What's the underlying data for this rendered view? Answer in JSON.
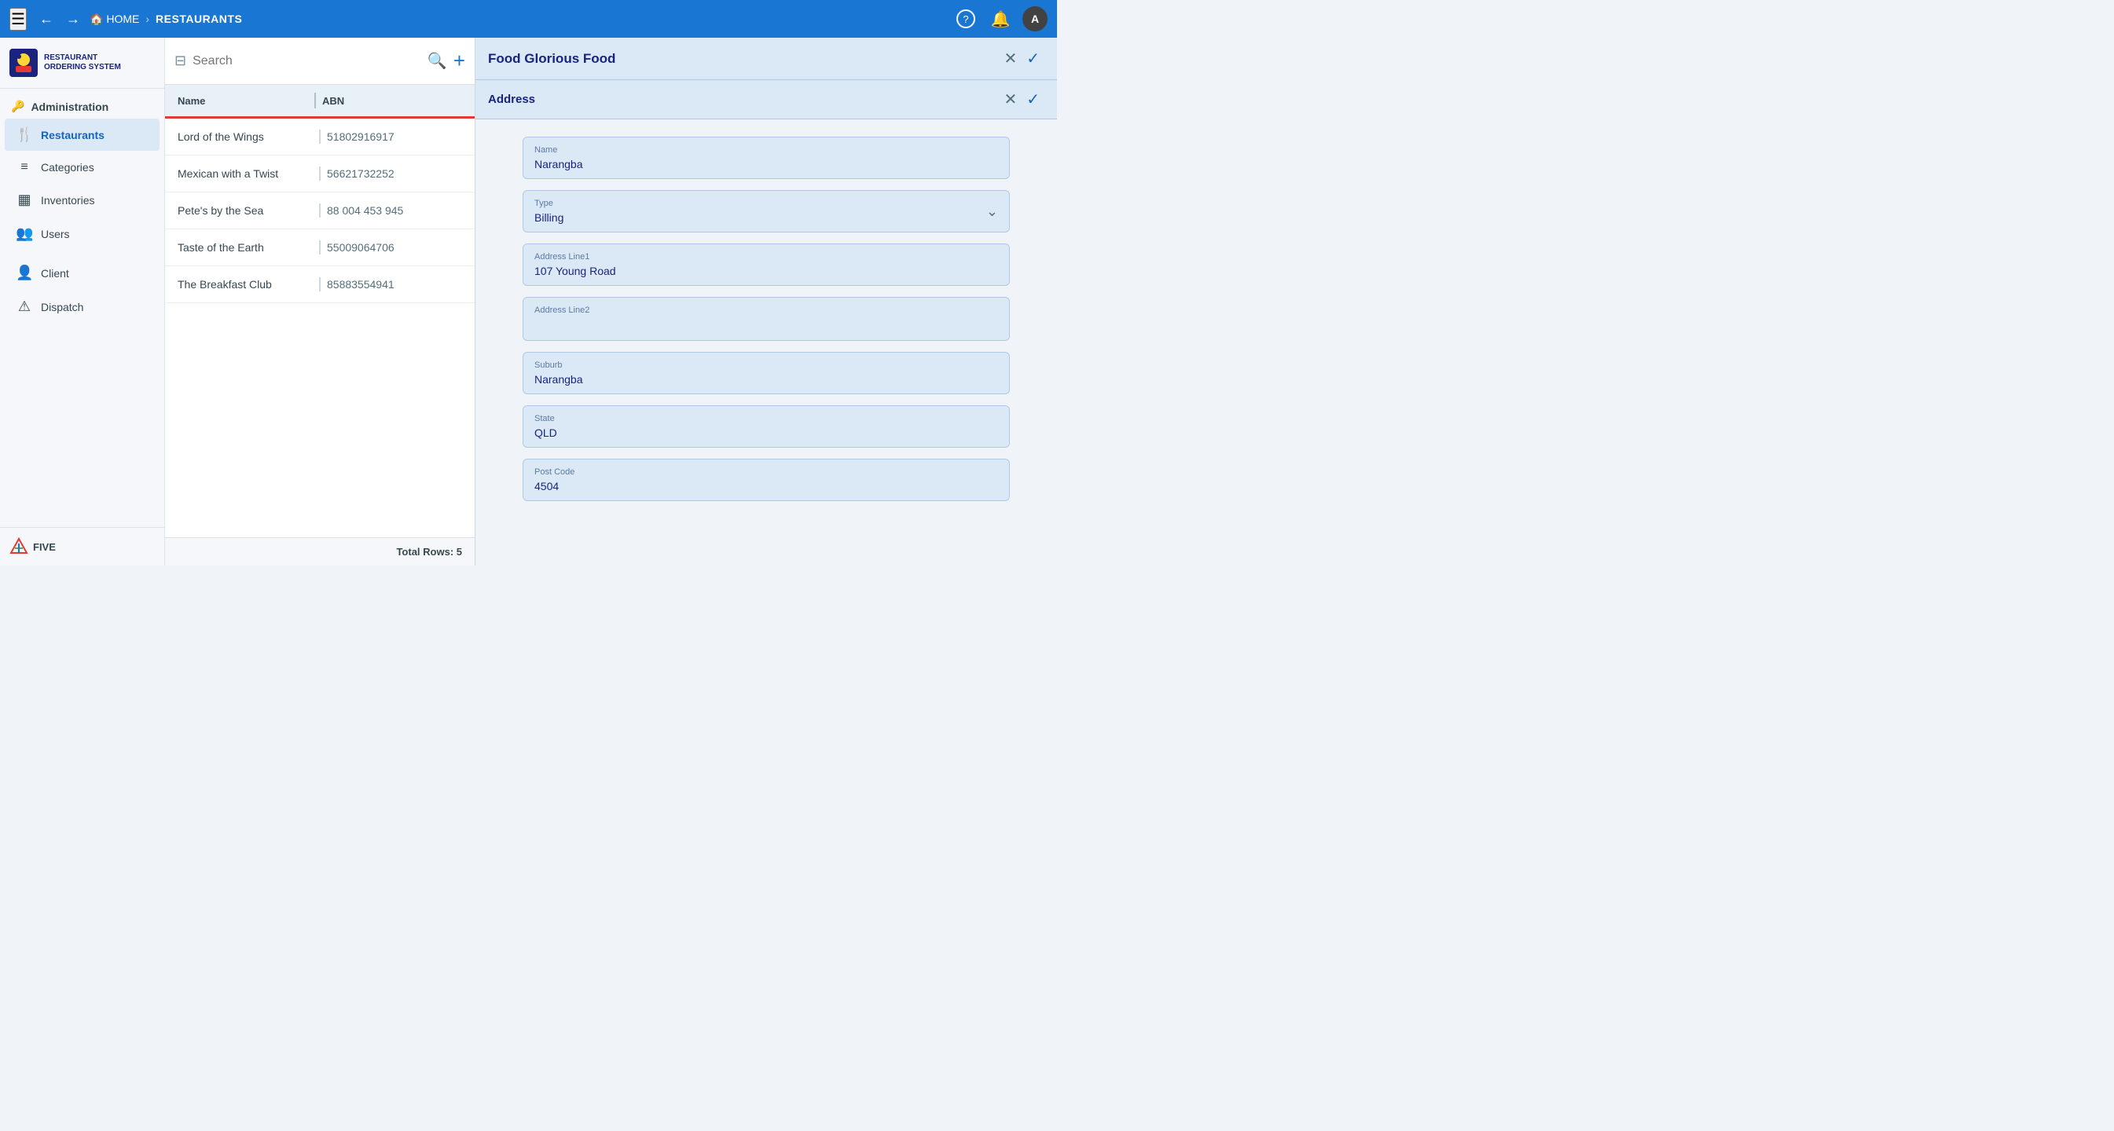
{
  "topbar": {
    "menu_icon": "☰",
    "back_icon": "←",
    "forward_icon": "→",
    "home_label": "HOME",
    "separator": "›",
    "page_label": "RESTAURANTS",
    "help_icon": "?",
    "bell_icon": "🔔",
    "avatar_label": "A"
  },
  "sidebar": {
    "logo_text_line1": "RESTAURANT",
    "logo_text_line2": "ORDERING SYSTEM",
    "section_administration": "Administration",
    "items": [
      {
        "id": "restaurants",
        "label": "Restaurants",
        "icon": "🍴",
        "active": true
      },
      {
        "id": "categories",
        "label": "Categories",
        "icon": "≡",
        "active": false
      },
      {
        "id": "inventories",
        "label": "Inventories",
        "icon": "▦",
        "active": false
      },
      {
        "id": "users",
        "label": "Users",
        "icon": "👥",
        "active": false
      }
    ],
    "section_client": "Client",
    "section_dispatch": "Dispatch",
    "five_logo": "FIVE"
  },
  "list": {
    "search_placeholder": "Search",
    "col_name": "Name",
    "col_abn": "ABN",
    "rows": [
      {
        "name": "Lord of the Wings",
        "abn": "51802916917"
      },
      {
        "name": "Mexican with a Twist",
        "abn": "56621732252"
      },
      {
        "name": "Pete's by the Sea",
        "abn": "88 004 453 945"
      },
      {
        "name": "Taste of the Earth",
        "abn": "55009064706"
      },
      {
        "name": "The Breakfast Club",
        "abn": "85883554941"
      }
    ],
    "footer": "Total Rows: 5"
  },
  "detail": {
    "title": "Food Glorious Food",
    "close_label": "✕",
    "check_label": "✓",
    "address_section": "Address",
    "fields": {
      "name_label": "Name",
      "name_value": "Narangba",
      "type_label": "Type",
      "type_value": "Billing",
      "address_line1_label": "Address Line1",
      "address_line1_value": "107 Young Road",
      "address_line2_label": "Address Line2",
      "address_line2_value": "",
      "suburb_label": "Suburb",
      "suburb_value": "Narangba",
      "state_label": "State",
      "state_value": "QLD",
      "postcode_label": "Post Code",
      "postcode_value": "4504"
    }
  }
}
